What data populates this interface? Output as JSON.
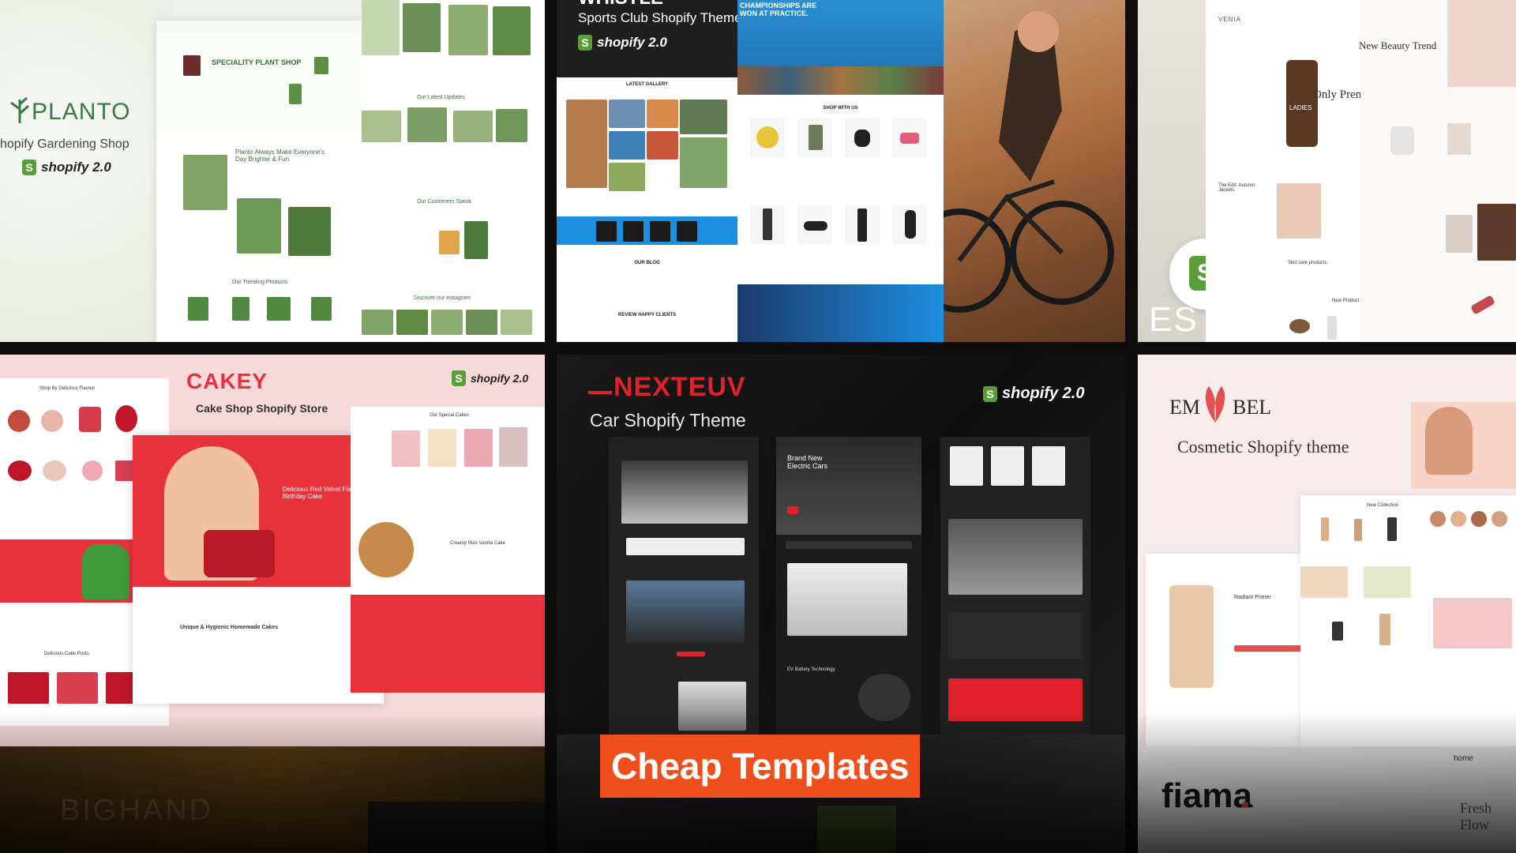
{
  "tiles": {
    "planto": {
      "brand": "PLANTO",
      "subtitle": "hopify Gardening Shop",
      "shopify": "shopify 2.0",
      "hero": "SPECIALITY PLANT SHOP",
      "section1": "Our Latest Updates",
      "section2": "Planto Always Make Everyone's Day Brighter & Fun",
      "section3": "Our Customers Speak",
      "section4": "Our Trending Products",
      "section5": "Discover our instagram"
    },
    "whistle": {
      "brand": "WHISTLE",
      "subtitle": "Sports Club Shopify Theme",
      "shopify": "shopify 2.0",
      "gallery": "LATEST GALLERY",
      "blog": "OUR BLOG",
      "clients": "REVIEW HAPPY CLIENTS",
      "shop": "SHOP WITH US",
      "champion": "CHAMPIONSHIPS ARE WON AT PRACTICE."
    },
    "venia": {
      "brand": "VENIA",
      "headline1": "New Beauty Trend",
      "headline2": "Only Premium T",
      "bottle_label": "LADIES",
      "letters": "ES",
      "caption1": "The Edit: Autumn Jackets",
      "caption2": "Skin care products",
      "caption3": "New Product"
    },
    "cakey": {
      "brand": "CAKEY",
      "subtitle": "Cake Shop Shopify Store",
      "shopify": "shopify 2.0",
      "section1": "Shop By Delicious Flavour",
      "section2": "Our Special Cakes",
      "hero": "Delicious Red Velvet Flavoured Birthday Cake",
      "section3": "Unique & Hygienic Homemade Cakes",
      "section4": "Delicious Cake Posts",
      "section5": "Creamy Nuts Vanilla Cake"
    },
    "nexteuv": {
      "brand": "NEXTEUV",
      "subtitle": "Car Shopify Theme",
      "shopify": "shopify 2.0",
      "hero": "Brand New Electric Cars",
      "section": "EV Battery Technology"
    },
    "embel": {
      "brand_left": "EM",
      "brand_right": "BEL",
      "subtitle": "Cosmetic Shopify theme",
      "product": "Radiant Primer",
      "section": "New Collection"
    },
    "bighand": {
      "brand": "BIGHAND"
    },
    "fiama": {
      "brand": "fiama",
      "tag": "home",
      "text": "Fresh Flow"
    }
  },
  "banner": {
    "label": "Cheap Templates"
  },
  "colors": {
    "banner_bg": "#ef4f1c",
    "planto_green": "#3c7a45",
    "cakey_red": "#e8323b",
    "nexteuv_red": "#e0202a",
    "shopify_green": "#5a9e3a"
  }
}
